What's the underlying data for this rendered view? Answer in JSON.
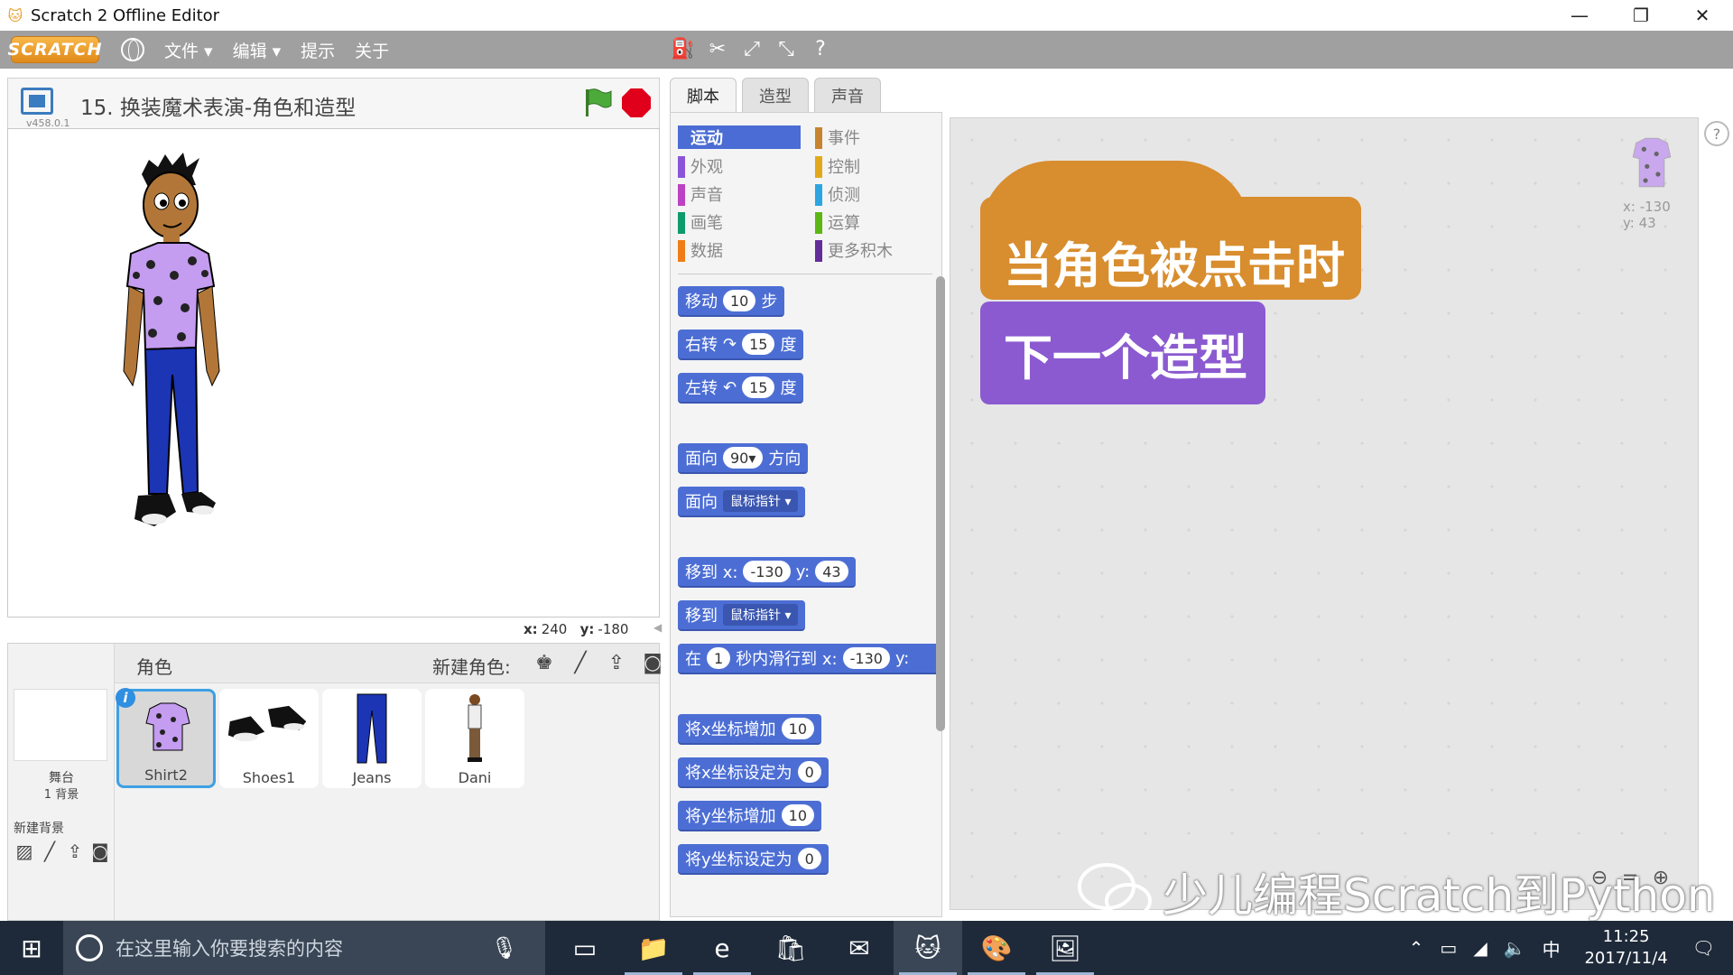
{
  "window": {
    "title": "Scratch 2 Offline Editor",
    "controls": [
      "—",
      "❐",
      "✕"
    ]
  },
  "menubar": {
    "logo": "SCRATCH",
    "menus": [
      "文件 ▾",
      "编辑 ▾",
      "提示",
      "关于"
    ],
    "tools": [
      "duplicate-icon",
      "delete-icon",
      "grow-icon",
      "shrink-icon",
      "help-icon"
    ]
  },
  "stage": {
    "project_name": "15. 换装魔术表演-角色和造型",
    "version": "v458.0.1",
    "coord_x_label": "x:",
    "coord_x": "240",
    "coord_y_label": "y:",
    "coord_y": "-180"
  },
  "sprites": {
    "label": "角色",
    "new_sprite_label": "新建角色:",
    "stage_name": "舞台",
    "stage_backdrops": "1 背景",
    "new_backdrop_label": "新建背景",
    "items": [
      {
        "name": "Shirt2",
        "selected": true
      },
      {
        "name": "Shoes1",
        "selected": false
      },
      {
        "name": "Jeans",
        "selected": false
      },
      {
        "name": "Dani",
        "selected": false
      }
    ]
  },
  "tabs": [
    "脚本",
    "造型",
    "声音"
  ],
  "categories": {
    "left": [
      {
        "label": "运动",
        "color": "#4a6cd4",
        "active": true
      },
      {
        "label": "外观",
        "color": "#8a55d7"
      },
      {
        "label": "声音",
        "color": "#bb42c3"
      },
      {
        "label": "画笔",
        "color": "#0e9a6c"
      },
      {
        "label": "数据",
        "color": "#ee7d16"
      }
    ],
    "right": [
      {
        "label": "事件",
        "color": "#c88330"
      },
      {
        "label": "控制",
        "color": "#e1a91a"
      },
      {
        "label": "侦测",
        "color": "#2ca5e2"
      },
      {
        "label": "运算",
        "color": "#5cb712"
      },
      {
        "label": "更多积木",
        "color": "#632d99"
      }
    ]
  },
  "blocks": {
    "move": {
      "a": "移动",
      "v": "10",
      "b": "步"
    },
    "turn_right": {
      "a": "右转",
      "icon": "↷",
      "v": "15",
      "b": "度"
    },
    "turn_left": {
      "a": "左转",
      "icon": "↶",
      "v": "15",
      "b": "度"
    },
    "point_dir": {
      "a": "面向",
      "v": "90▾",
      "b": "方向"
    },
    "point_towards": {
      "a": "面向",
      "v": "鼠标指针 ▾"
    },
    "goto_xy": {
      "a": "移到 x:",
      "x": "-130",
      "yl": "y:",
      "y": "43"
    },
    "goto": {
      "a": "移到",
      "v": "鼠标指针 ▾"
    },
    "glide": {
      "a": "在",
      "t": "1",
      "b": "秒内滑行到 x:",
      "x": "-130",
      "yl": "y:"
    },
    "change_x": {
      "a": "将x坐标增加",
      "v": "10"
    },
    "set_x": {
      "a": "将x坐标设定为",
      "v": "0"
    },
    "change_y": {
      "a": "将y坐标增加",
      "v": "10"
    },
    "set_y": {
      "a": "将y坐标设定为",
      "v": "0"
    }
  },
  "script": {
    "hat": "当角色被点击时",
    "command": "下一个造型"
  },
  "sprite_info": {
    "x": "x: -130",
    "y": "y: 43"
  },
  "watermark": "少儿编程Scratch到Python",
  "taskbar": {
    "search_placeholder": "在这里输入你要搜索的内容",
    "ime": "中",
    "time": "11:25",
    "date": "2017/11/4"
  }
}
